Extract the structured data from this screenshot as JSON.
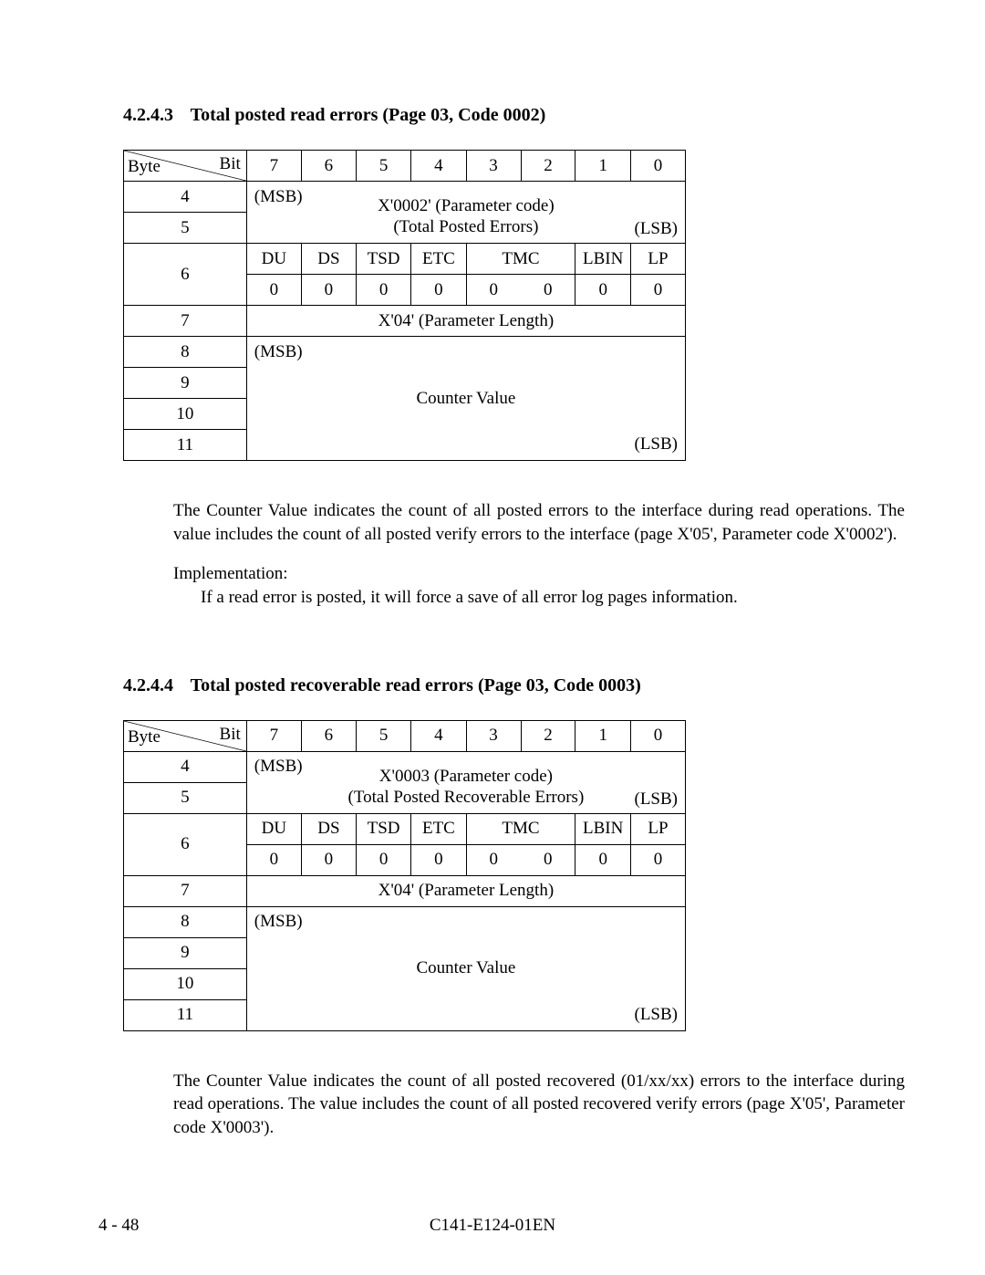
{
  "section1": {
    "number": "4.2.4.3",
    "title": "Total posted read errors (Page 03, Code 0002)",
    "table": {
      "hdr_bit": "Bit",
      "hdr_byte": "Byte",
      "bits": [
        "7",
        "6",
        "5",
        "4",
        "3",
        "2",
        "1",
        "0"
      ],
      "r4": "4",
      "r5": "5",
      "r6": "6",
      "r7": "7",
      "r8": "8",
      "r9": "9",
      "r10": "10",
      "r11": "11",
      "msb": "(MSB)",
      "lsb": "(LSB)",
      "paramcode_l1": "X'0002' (Parameter code)",
      "paramcode_l2": "(Total Posted Errors)",
      "flags": [
        "DU",
        "DS",
        "TSD",
        "ETC",
        "TMC",
        "LBIN",
        "LP"
      ],
      "zeros": [
        "0",
        "0",
        "0",
        "0",
        "0",
        "0",
        "0",
        "0"
      ],
      "paramlen": "X'04' (Parameter Length)",
      "counter": "Counter Value"
    },
    "para": "The Counter Value indicates the count of all posted errors to the interface during read operations. The value includes the count of all posted verify errors to the interface (page X'05', Parameter code X'0002').",
    "impl_label": "Implementation:",
    "impl_body": "If a read error is posted, it will force a save of all error log pages information."
  },
  "section2": {
    "number": "4.2.4.4",
    "title": "Total posted recoverable read errors (Page 03, Code 0003)",
    "table": {
      "hdr_bit": "Bit",
      "hdr_byte": "Byte",
      "bits": [
        "7",
        "6",
        "5",
        "4",
        "3",
        "2",
        "1",
        "0"
      ],
      "r4": "4",
      "r5": "5",
      "r6": "6",
      "r7": "7",
      "r8": "8",
      "r9": "9",
      "r10": "10",
      "r11": "11",
      "msb": "(MSB)",
      "lsb": "(LSB)",
      "paramcode_l1": "X'0003 (Parameter code)",
      "paramcode_l2": "(Total Posted Recoverable Errors)",
      "flags": [
        "DU",
        "DS",
        "TSD",
        "ETC",
        "TMC",
        "LBIN",
        "LP"
      ],
      "zeros": [
        "0",
        "0",
        "0",
        "0",
        "0",
        "0",
        "0",
        "0"
      ],
      "paramlen": "X'04' (Parameter Length)",
      "counter": "Counter Value"
    },
    "para": "The Counter Value indicates the count of all posted recovered (01/xx/xx) errors to the interface during read operations.  The value includes the count of all posted recovered verify errors (page X'05', Parameter code X'0003')."
  },
  "footer": {
    "page": "4 - 48",
    "docid": "C141-E124-01EN"
  }
}
